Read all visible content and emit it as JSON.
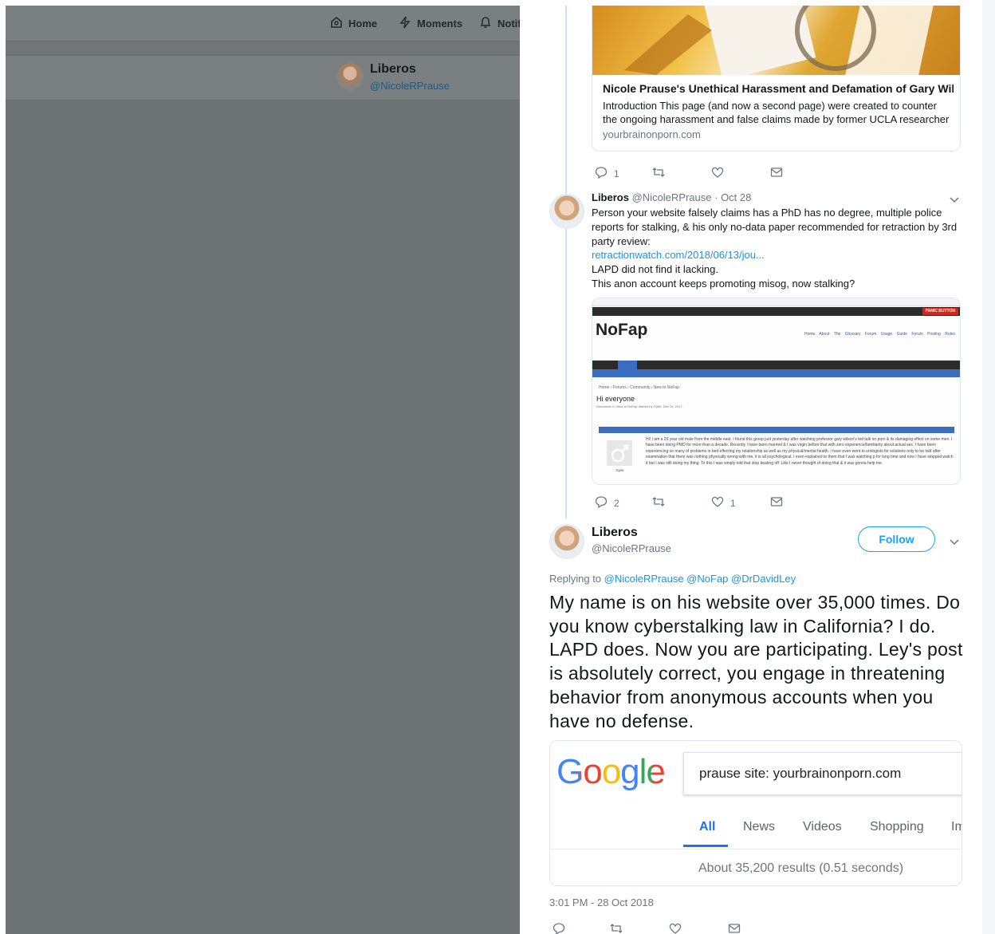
{
  "nav": {
    "home": "Home",
    "moments": "Moments",
    "notifications": "Notif"
  },
  "profile_bar": {
    "name": "Liberos",
    "handle": "@NicoleRPrause"
  },
  "card1": {
    "title": "Nicole Prause's Unethical Harassment and Defamation of Gary Wilso...",
    "description": "Introduction This page (and now a second page) were created to counter the ongoing harassment and false claims made by former UCLA researcher",
    "domain": "yourbrainonporn.com"
  },
  "tweet1_actions": {
    "replies": "1",
    "retweets": "",
    "likes": ""
  },
  "tweet2": {
    "name": "Liberos",
    "handle": "@NicoleRPrause",
    "date": "· Oct 28",
    "line1": "Person your website falsely claims has a PhD has no degree, multiple police reports for stalking, & his only no-data paper recommended for retraction by 3rd party review:",
    "link": "retractionwatch.com/2018/06/13/jou...",
    "line2": "LAPD did not find it lacking.",
    "line3": "This anon account keeps promoting misog, now stalking?",
    "screenshot": {
      "logo": "NoFap",
      "menu": "Home About The Glossary Forum Usage Guide Forum Posting Rules",
      "panic": "PANIC BUTTON",
      "crumb": "Home › Forums › Community › New to NoFap",
      "title": "Hi everyone",
      "meta": "Discussion in 'New to NoFap' started by TQ89, Dec 16, 2017.",
      "user": "TQ89",
      "post": "Hi! I am a 29 year old male from the middle east. I found this group just yesterday after watching professor gary wilson's ted talk on porn & its damaging effect on some men. I have been doing PMO for more than a decade. Recently I have been married & I was virgin before that with zero experience/familiarity about actual sex. I have been experiencing so many of problems in bed effecting my relationship as well as my physical/mental health. I have even went to urologists for solutions only to be told after examination that there was nothing physically wrong with me, it is all psychological. I even explained to them that I was watching p for long time and now I have stopped watch it but I was still doing my thing. To this I was simply told that stop beating off. Like I never thought of doing that & it was gonna help me."
    },
    "actions": {
      "replies": "2",
      "retweets": "",
      "likes": "1"
    }
  },
  "tweet3": {
    "name": "Liberos",
    "handle": "@NicoleRPrause",
    "follow_label": "Follow",
    "replying_prefix": "Replying to",
    "replying_to": "@NicoleRPrause @NoFap @DrDavidLey",
    "body": "My name is on his website over 35,000 times. Do you know cyberstalking law in California? I do. LAPD does. Now you are participating. Ley's post is absolutely correct, you engage in threatening behavior from anonymous accounts when you have no defense.",
    "google": {
      "logo": "Google",
      "query": "prause site: yourbrainonporn.com",
      "tabs": [
        "All",
        "News",
        "Videos",
        "Shopping",
        "Im"
      ],
      "results": "About 35,200 results (0.51 seconds)"
    },
    "timestamp": "3:01 PM - 28 Oct 2018"
  },
  "colors": {
    "accent": "#1da1f2",
    "link": "#1b95e0",
    "muted": "#657786",
    "google_blue": "#4285f4",
    "google_red": "#ea4335",
    "google_yellow": "#fbbc05",
    "google_green": "#34a853"
  },
  "icons": [
    "home-icon",
    "moments-icon",
    "notifications-icon",
    "reply-icon",
    "retweet-icon",
    "like-icon",
    "message-icon",
    "chevron-down-icon"
  ]
}
